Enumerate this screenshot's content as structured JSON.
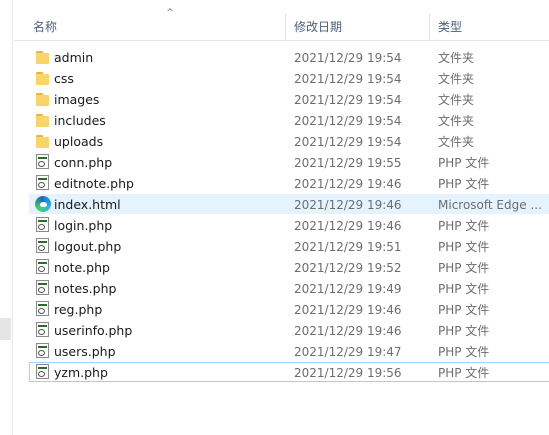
{
  "columns": {
    "name": "名称",
    "date": "修改日期",
    "type": "类型"
  },
  "rows": [
    {
      "name": "admin",
      "date": "2021/12/29 19:54",
      "type": "文件夹",
      "icon": "folder-icon"
    },
    {
      "name": "css",
      "date": "2021/12/29 19:54",
      "type": "文件夹",
      "icon": "folder-icon"
    },
    {
      "name": "images",
      "date": "2021/12/29 19:54",
      "type": "文件夹",
      "icon": "folder-icon"
    },
    {
      "name": "includes",
      "date": "2021/12/29 19:54",
      "type": "文件夹",
      "icon": "folder-icon"
    },
    {
      "name": "uploads",
      "date": "2021/12/29 19:54",
      "type": "文件夹",
      "icon": "folder-icon"
    },
    {
      "name": "conn.php",
      "date": "2021/12/29 19:55",
      "type": "PHP 文件",
      "icon": "php-file-icon"
    },
    {
      "name": "editnote.php",
      "date": "2021/12/29 19:46",
      "type": "PHP 文件",
      "icon": "php-file-icon"
    },
    {
      "name": "index.html",
      "date": "2021/12/29 19:46",
      "type": "Microsoft Edge ...",
      "icon": "edge-icon"
    },
    {
      "name": "login.php",
      "date": "2021/12/29 19:46",
      "type": "PHP 文件",
      "icon": "php-file-icon"
    },
    {
      "name": "logout.php",
      "date": "2021/12/29 19:51",
      "type": "PHP 文件",
      "icon": "php-file-icon"
    },
    {
      "name": "note.php",
      "date": "2021/12/29 19:52",
      "type": "PHP 文件",
      "icon": "php-file-icon"
    },
    {
      "name": "notes.php",
      "date": "2021/12/29 19:49",
      "type": "PHP 文件",
      "icon": "php-file-icon"
    },
    {
      "name": "reg.php",
      "date": "2021/12/29 19:46",
      "type": "PHP 文件",
      "icon": "php-file-icon"
    },
    {
      "name": "userinfo.php",
      "date": "2021/12/29 19:46",
      "type": "PHP 文件",
      "icon": "php-file-icon"
    },
    {
      "name": "users.php",
      "date": "2021/12/29 19:47",
      "type": "PHP 文件",
      "icon": "php-file-icon"
    },
    {
      "name": "yzm.php",
      "date": "2021/12/29 19:56",
      "type": "PHP 文件",
      "icon": "php-file-icon"
    }
  ],
  "selected_row": "index.html",
  "focused_row": "yzm.php",
  "colors": {
    "selection": "#e5f3ff",
    "focus_border": "#99d1ff",
    "header_text": "#4c607a"
  }
}
